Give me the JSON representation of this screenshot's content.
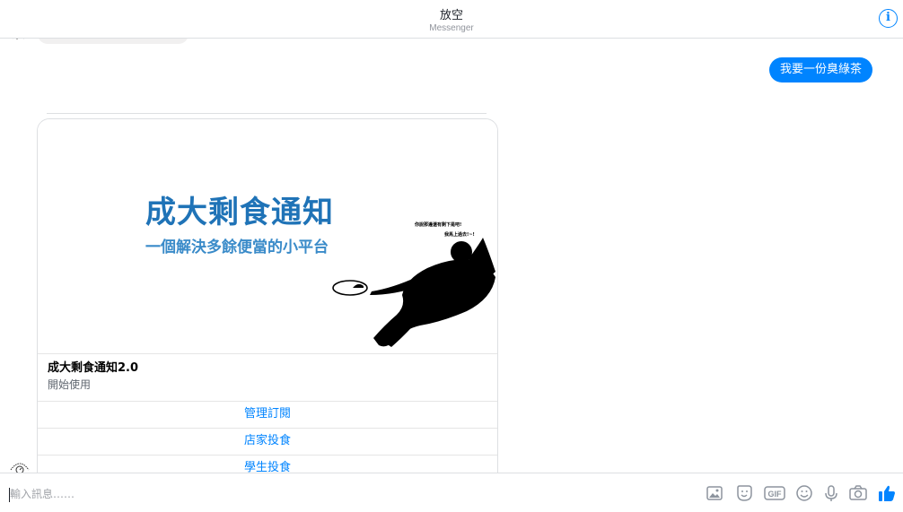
{
  "header": {
    "title": "放空",
    "subtitle": "Messenger",
    "info_icon": "info-icon",
    "info_glyph": "i"
  },
  "conversation": {
    "user_message": "我要一份臭綠茶",
    "card": {
      "image": {
        "headline": "成大剩食通知",
        "tagline": "一個解決多餘便當的小平台",
        "speech_line_1": "你說那邊還有剩下是吧!",
        "speech_line_2": "我馬上過去!~!"
      },
      "title": "成大剩食通知2.0",
      "subtitle": "開始使用",
      "buttons": [
        {
          "label": "管理訂閱"
        },
        {
          "label": "店家投食"
        },
        {
          "label": "學生投食"
        }
      ]
    }
  },
  "composer": {
    "placeholder": "輸入訊息……",
    "value": "",
    "icons": [
      "image-icon",
      "sticker-icon",
      "gif-icon",
      "emoji-icon",
      "microphone-icon",
      "camera-icon",
      "like-icon"
    ],
    "gif_label": "GIF"
  },
  "colors": {
    "accent": "#0084ff",
    "bubble_gray": "#f1f0f0",
    "promo_blue": "#1f73b7"
  }
}
